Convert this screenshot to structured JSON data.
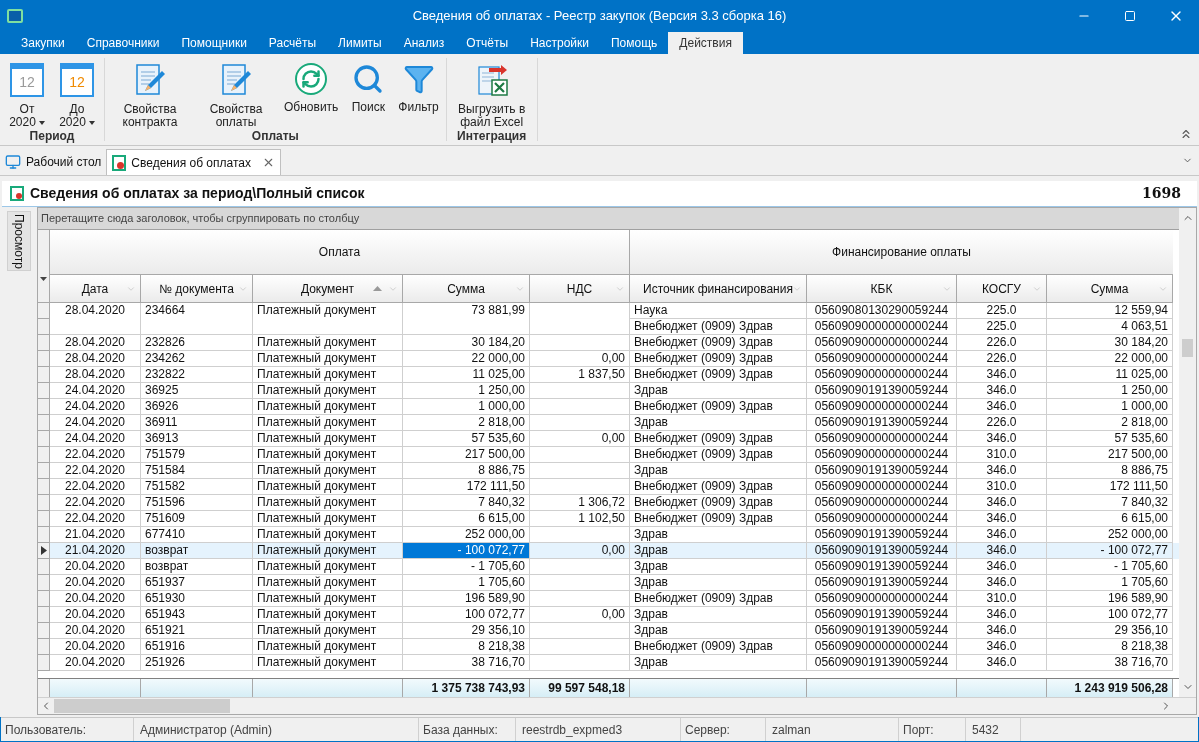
{
  "window": {
    "title": "Сведения об оплатах - Реестр закупок (Версия 3.3 сборка 16)"
  },
  "menu_tabs": [
    {
      "label": "Закупки",
      "selected": false
    },
    {
      "label": "Справочники",
      "selected": false
    },
    {
      "label": "Помощники",
      "selected": false
    },
    {
      "label": "Расчёты",
      "selected": false
    },
    {
      "label": "Лимиты",
      "selected": false
    },
    {
      "label": "Анализ",
      "selected": false
    },
    {
      "label": "Отчёты",
      "selected": false
    },
    {
      "label": "Настройки",
      "selected": false
    },
    {
      "label": "Помощь",
      "selected": false
    },
    {
      "label": "Действия",
      "selected": true
    }
  ],
  "ribbon": {
    "groups": [
      {
        "title": "Период",
        "buttons": [
          {
            "kind": "date",
            "label": "От",
            "value": "2020",
            "day": "12",
            "color": "#9a9a9a"
          },
          {
            "kind": "date",
            "label": "До",
            "value": "2020",
            "day": "12",
            "color": "#f08a00"
          }
        ]
      },
      {
        "title": "Оплаты",
        "buttons": [
          {
            "kind": "edit",
            "label": "Свойства контракта"
          },
          {
            "kind": "edit",
            "label": "Свойства оплаты"
          },
          {
            "kind": "refresh",
            "label": "Обновить"
          },
          {
            "kind": "search",
            "label": "Поиск"
          },
          {
            "kind": "filter",
            "label": "Фильтр"
          }
        ]
      },
      {
        "title": "Интеграция",
        "buttons": [
          {
            "kind": "excel",
            "label": "Выгрузить в файл Excel"
          }
        ]
      }
    ]
  },
  "doc_tabs": [
    {
      "kind": "desktop",
      "label": "Рабочий стол",
      "selected": false,
      "closable": false
    },
    {
      "kind": "document",
      "label": "Сведения об оплатах",
      "selected": true,
      "closable": true
    }
  ],
  "panel": {
    "title": "Сведения об оплатах за период\\Полный список",
    "count": "1698",
    "side_tab": "Просмотр"
  },
  "grid": {
    "group_hint": "Перетащите сюда заголовок, чтобы сгруппировать по столбцу",
    "bands": [
      "Оплата",
      "Финансирование оплаты"
    ],
    "columns": [
      {
        "label": "Дата",
        "sorted": false
      },
      {
        "label": "№ документа",
        "sorted": false
      },
      {
        "label": "Документ",
        "sorted": true
      },
      {
        "label": "Сумма",
        "sorted": false
      },
      {
        "label": "НДС",
        "sorted": false
      },
      {
        "label": "Источник финансирования",
        "sorted": false
      },
      {
        "label": "КБК",
        "sorted": false
      },
      {
        "label": "КОСГУ",
        "sorted": false
      },
      {
        "label": "Сумма",
        "sorted": false
      }
    ],
    "rows": [
      {
        "date": "28.04.2020",
        "number": "234664",
        "document": "Платежный документ",
        "sum": "73 881,99",
        "vat": "",
        "selected": false,
        "funding": [
          {
            "source": "Наука",
            "kbk": "05609080130290059244",
            "kosgu": "225.0",
            "sum": "12 559,94"
          },
          {
            "source": "Внебюджет (0909) Здрав",
            "kbk": "05609090000000000244",
            "kosgu": "225.0",
            "sum": "4 063,51"
          }
        ]
      },
      {
        "date": "28.04.2020",
        "number": "232826",
        "document": "Платежный документ",
        "sum": "30 184,20",
        "vat": "",
        "selected": false,
        "funding": [
          {
            "source": "Внебюджет (0909) Здрав",
            "kbk": "05609090000000000244",
            "kosgu": "226.0",
            "sum": "30 184,20"
          }
        ]
      },
      {
        "date": "28.04.2020",
        "number": "234262",
        "document": "Платежный документ",
        "sum": "22 000,00",
        "vat": "0,00",
        "selected": false,
        "funding": [
          {
            "source": "Внебюджет (0909) Здрав",
            "kbk": "05609090000000000244",
            "kosgu": "226.0",
            "sum": "22 000,00"
          }
        ]
      },
      {
        "date": "28.04.2020",
        "number": "232822",
        "document": "Платежный документ",
        "sum": "11 025,00",
        "vat": "1 837,50",
        "selected": false,
        "funding": [
          {
            "source": "Внебюджет (0909) Здрав",
            "kbk": "05609090000000000244",
            "kosgu": "346.0",
            "sum": "11 025,00"
          }
        ]
      },
      {
        "date": "24.04.2020",
        "number": "36925",
        "document": "Платежный документ",
        "sum": "1 250,00",
        "vat": "",
        "selected": false,
        "funding": [
          {
            "source": "Здрав",
            "kbk": "05609090191390059244",
            "kosgu": "346.0",
            "sum": "1 250,00"
          }
        ]
      },
      {
        "date": "24.04.2020",
        "number": "36926",
        "document": "Платежный документ",
        "sum": "1 000,00",
        "vat": "",
        "selected": false,
        "funding": [
          {
            "source": "Внебюджет (0909) Здрав",
            "kbk": "05609090000000000244",
            "kosgu": "346.0",
            "sum": "1 000,00"
          }
        ]
      },
      {
        "date": "24.04.2020",
        "number": "36911",
        "document": "Платежный документ",
        "sum": "2 818,00",
        "vat": "",
        "selected": false,
        "funding": [
          {
            "source": "Здрав",
            "kbk": "05609090191390059244",
            "kosgu": "226.0",
            "sum": "2 818,00"
          }
        ]
      },
      {
        "date": "24.04.2020",
        "number": "36913",
        "document": "Платежный документ",
        "sum": "57 535,60",
        "vat": "0,00",
        "selected": false,
        "funding": [
          {
            "source": "Внебюджет (0909) Здрав",
            "kbk": "05609090000000000244",
            "kosgu": "346.0",
            "sum": "57 535,60"
          }
        ]
      },
      {
        "date": "22.04.2020",
        "number": "751579",
        "document": "Платежный документ",
        "sum": "217 500,00",
        "vat": "",
        "selected": false,
        "funding": [
          {
            "source": "Внебюджет (0909) Здрав",
            "kbk": "05609090000000000244",
            "kosgu": "310.0",
            "sum": "217 500,00"
          }
        ]
      },
      {
        "date": "22.04.2020",
        "number": "751584",
        "document": "Платежный документ",
        "sum": "8 886,75",
        "vat": "",
        "selected": false,
        "funding": [
          {
            "source": "Здрав",
            "kbk": "05609090191390059244",
            "kosgu": "346.0",
            "sum": "8 886,75"
          }
        ]
      },
      {
        "date": "22.04.2020",
        "number": "751582",
        "document": "Платежный документ",
        "sum": "172 111,50",
        "vat": "",
        "selected": false,
        "funding": [
          {
            "source": "Внебюджет (0909) Здрав",
            "kbk": "05609090000000000244",
            "kosgu": "310.0",
            "sum": "172 111,50"
          }
        ]
      },
      {
        "date": "22.04.2020",
        "number": "751596",
        "document": "Платежный документ",
        "sum": "7 840,32",
        "vat": "1 306,72",
        "selected": false,
        "funding": [
          {
            "source": "Внебюджет (0909) Здрав",
            "kbk": "05609090000000000244",
            "kosgu": "346.0",
            "sum": "7 840,32"
          }
        ]
      },
      {
        "date": "22.04.2020",
        "number": "751609",
        "document": "Платежный документ",
        "sum": "6 615,00",
        "vat": "1 102,50",
        "selected": false,
        "funding": [
          {
            "source": "Внебюджет (0909) Здрав",
            "kbk": "05609090000000000244",
            "kosgu": "346.0",
            "sum": "6 615,00"
          }
        ]
      },
      {
        "date": "21.04.2020",
        "number": "677410",
        "document": "Платежный документ",
        "sum": "252 000,00",
        "vat": "",
        "selected": false,
        "funding": [
          {
            "source": "Здрав",
            "kbk": "05609090191390059244",
            "kosgu": "346.0",
            "sum": "252 000,00"
          }
        ]
      },
      {
        "date": "21.04.2020",
        "number": "возврат",
        "document": "Платежный документ",
        "sum": "-  100 072,77",
        "vat": "0,00",
        "selected": true,
        "funding": [
          {
            "source": "Здрав",
            "kbk": "05609090191390059244",
            "kosgu": "346.0",
            "sum": "-  100 072,77"
          }
        ]
      },
      {
        "date": "20.04.2020",
        "number": "возврат",
        "document": "Платежный документ",
        "sum": "-  1 705,60",
        "vat": "",
        "selected": false,
        "funding": [
          {
            "source": "Здрав",
            "kbk": "05609090191390059244",
            "kosgu": "346.0",
            "sum": "-  1 705,60"
          }
        ]
      },
      {
        "date": "20.04.2020",
        "number": "651937",
        "document": "Платежный документ",
        "sum": "1 705,60",
        "vat": "",
        "selected": false,
        "funding": [
          {
            "source": "Здрав",
            "kbk": "05609090191390059244",
            "kosgu": "346.0",
            "sum": "1 705,60"
          }
        ]
      },
      {
        "date": "20.04.2020",
        "number": "651930",
        "document": "Платежный документ",
        "sum": "196 589,90",
        "vat": "",
        "selected": false,
        "funding": [
          {
            "source": "Внебюджет (0909) Здрав",
            "kbk": "05609090000000000244",
            "kosgu": "310.0",
            "sum": "196 589,90"
          }
        ]
      },
      {
        "date": "20.04.2020",
        "number": "651943",
        "document": "Платежный документ",
        "sum": "100 072,77",
        "vat": "0,00",
        "selected": false,
        "funding": [
          {
            "source": "Здрав",
            "kbk": "05609090191390059244",
            "kosgu": "346.0",
            "sum": "100 072,77"
          }
        ]
      },
      {
        "date": "20.04.2020",
        "number": "651921",
        "document": "Платежный документ",
        "sum": "29 356,10",
        "vat": "",
        "selected": false,
        "funding": [
          {
            "source": "Здрав",
            "kbk": "05609090191390059244",
            "kosgu": "346.0",
            "sum": "29 356,10"
          }
        ]
      },
      {
        "date": "20.04.2020",
        "number": "651916",
        "document": "Платежный документ",
        "sum": "8 218,38",
        "vat": "",
        "selected": false,
        "funding": [
          {
            "source": "Внебюджет (0909) Здрав",
            "kbk": "05609090000000000244",
            "kosgu": "346.0",
            "sum": "8 218,38"
          }
        ]
      },
      {
        "date": "20.04.2020",
        "number": "251926",
        "document": "Платежный документ",
        "sum": "38 716,70",
        "vat": "",
        "selected": false,
        "funding": [
          {
            "source": "Здрав",
            "kbk": "05609090191390059244",
            "kosgu": "346.0",
            "sum": "38 716,70"
          }
        ]
      }
    ],
    "totals": {
      "sum": "1 375 738 743,93",
      "vat": "99 597 548,18",
      "funding_sum": "1 243 919 506,28"
    }
  },
  "status_bar": [
    {
      "label": "Пользователь:",
      "value": "Администратор (Admin)"
    },
    {
      "label": "База данных:",
      "value": "reestrdb_expmed3"
    },
    {
      "label": "Сервер:",
      "value": "zalman"
    },
    {
      "label": "Порт:",
      "value": "5432"
    }
  ]
}
